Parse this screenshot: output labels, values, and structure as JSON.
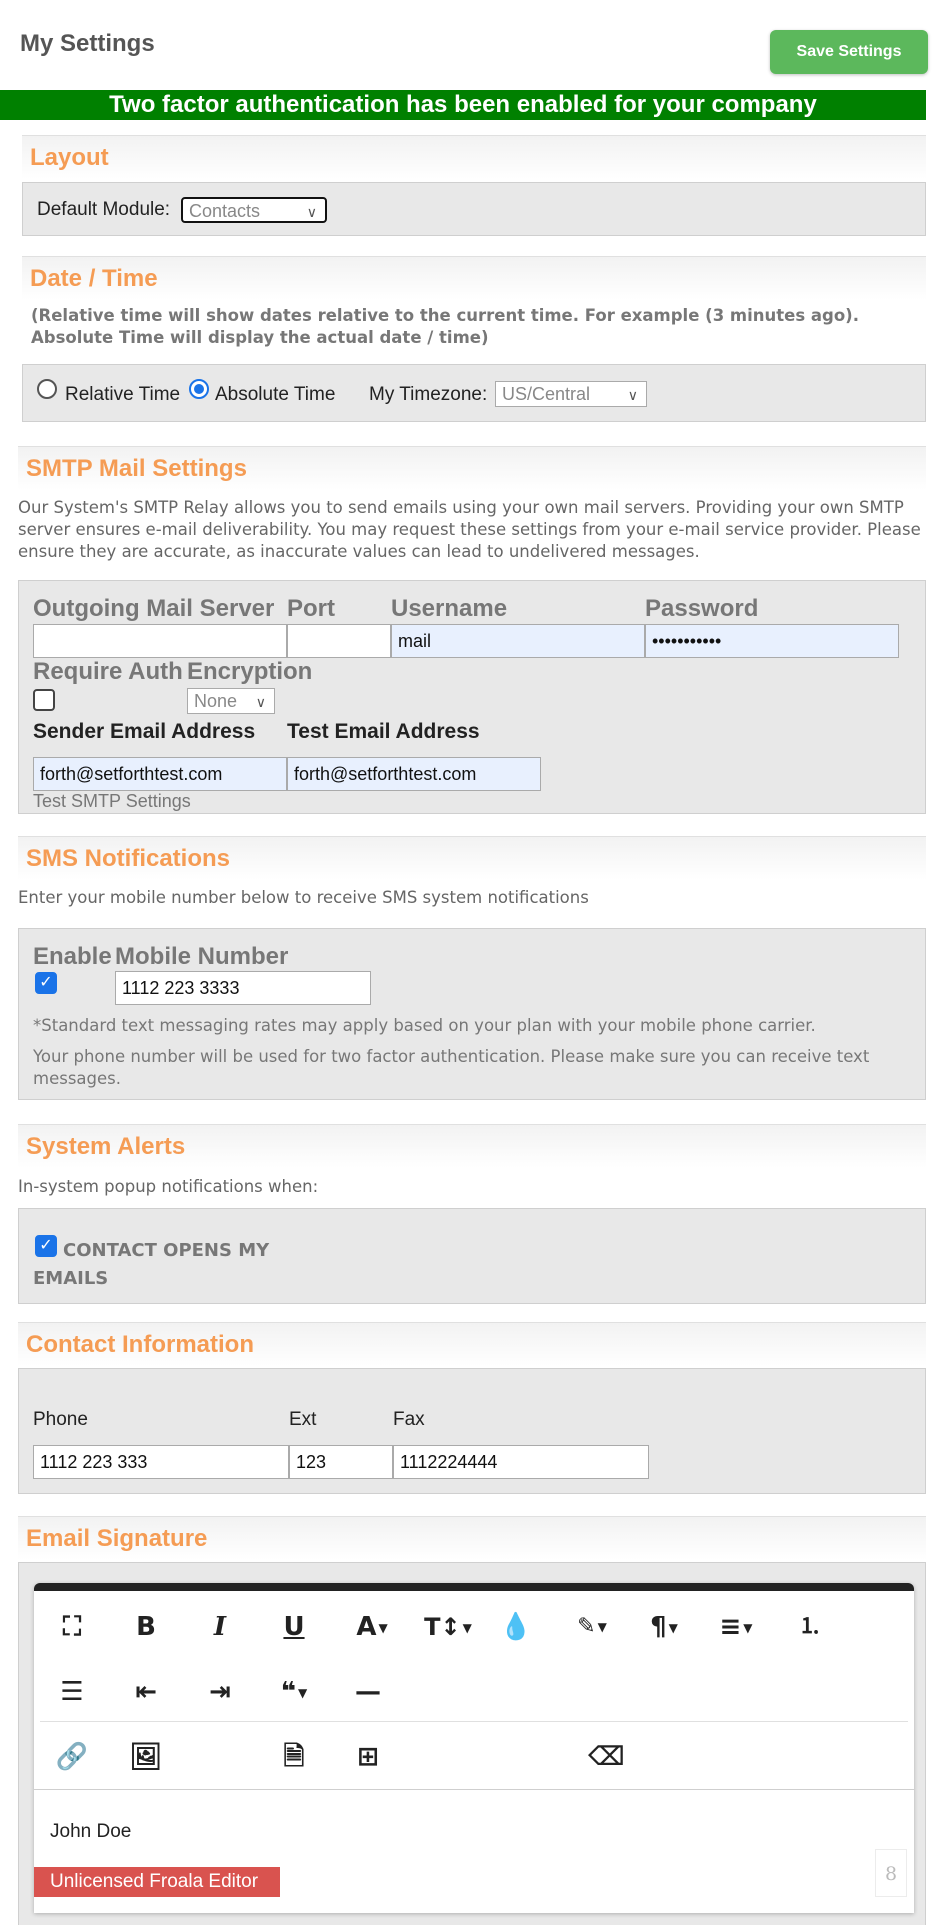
{
  "header": {
    "title": "My Settings",
    "save_label": "Save Settings"
  },
  "banner": "Two factor authentication has been enabled for your company",
  "layout": {
    "heading": "Layout",
    "default_module_label": "Default Module:",
    "default_module_value": "Contacts"
  },
  "datetime": {
    "heading": "Date / Time",
    "note": "(Relative time will show dates relative to the current time. For example (3 minutes ago). Absolute Time will display the actual date / time)",
    "relative_label": "Relative Time",
    "absolute_label": "Absolute Time",
    "selected": "Absolute Time",
    "timezone_label": "My Timezone:",
    "timezone_value": "US/Central"
  },
  "smtp": {
    "heading": "SMTP Mail Settings",
    "description": "Our System's SMTP Relay allows you to send emails using your own mail servers. Providing your own SMTP server ensures e-mail deliverability. You may request these settings from your e-mail service provider. Please ensure they are accurate, as inaccurate values can lead to undelivered messages.",
    "outgoing_label": "Outgoing Mail Server",
    "port_label": "Port",
    "username_label": "Username",
    "password_label": "Password",
    "outgoing_value": "",
    "port_value": "",
    "username_value": "mail",
    "password_value": "•••••••••••",
    "require_auth_label": "Require Auth",
    "require_auth_checked": false,
    "encryption_label": "Encryption",
    "encryption_value": "None",
    "sender_label": "Sender Email Address",
    "test_label": "Test Email Address",
    "sender_value": "forth@setforthtest.com",
    "test_value": "forth@setforthtest.com",
    "test_link": "Test SMTP Settings"
  },
  "sms": {
    "heading": "SMS Notifications",
    "description": "Enter your mobile number below to receive SMS system notifications",
    "enable_label": "Enable",
    "enable_checked": true,
    "mobile_label": "Mobile Number",
    "mobile_value": "1112 223 3333",
    "rates_note": "*Standard text messaging rates may apply based on your plan with your mobile phone carrier.",
    "twofactor_note": "Your phone number will be used for two factor authentication. Please make sure you can receive text messages."
  },
  "alerts": {
    "heading": "System Alerts",
    "description": "In-system popup notifications when:",
    "contact_opens_label": "CONTACT OPENS MY EMAILS",
    "contact_opens_checked": true
  },
  "contact": {
    "heading": "Contact Information",
    "phone_label": "Phone",
    "ext_label": "Ext",
    "fax_label": "Fax",
    "phone_value": "1112 223 333",
    "ext_value": "123",
    "fax_value": "1112224444"
  },
  "signature": {
    "heading": "Email Signature",
    "content": "John Doe",
    "unlicensed": "Unlicensed Froala Editor",
    "counter": "8",
    "toolbar_icons": [
      "fullscreen-icon",
      "bold-icon",
      "italic-icon",
      "underline-icon",
      "font-family-icon",
      "font-size-icon",
      "color-icon",
      "paragraph-style-icon",
      "paragraph-format-icon",
      "align-icon",
      "ordered-list-icon",
      "unordered-list-icon",
      "outdent-icon",
      "indent-icon",
      "quote-icon",
      "horizontal-line-icon",
      "link-icon",
      "image-icon",
      "file-icon",
      "table-icon",
      "clear-formatting-icon"
    ]
  },
  "colors": {
    "accent": "#f59c54",
    "save_button": "#5cb85c",
    "banner": "#008000",
    "unlicensed": "#d9534f"
  }
}
